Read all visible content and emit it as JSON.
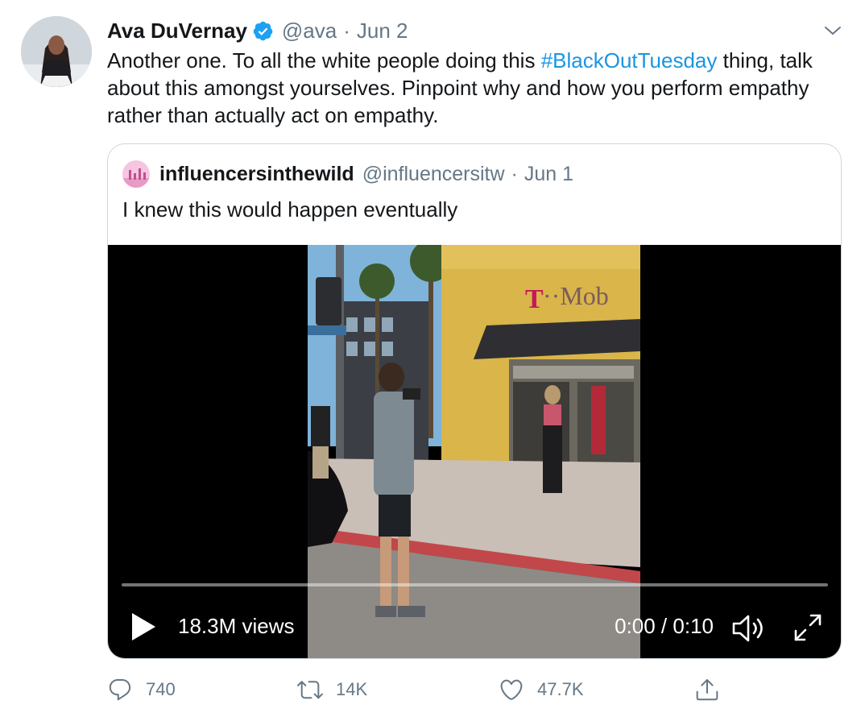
{
  "tweet": {
    "display_name": "Ava DuVernay",
    "handle": "@ava",
    "separator": "·",
    "date": "Jun 2",
    "text_before": "Another one. To all the white people doing this ",
    "hashtag": "#BlackOutTuesday",
    "text_after": " thing, talk about this amongst yourselves. Pinpoint why and how you perform empathy rather than actually act on empathy."
  },
  "quote": {
    "display_name": "influencersinthewild",
    "handle": "@influencersitw",
    "separator": "·",
    "date": "Jun 1",
    "text": "I knew this would happen eventually",
    "video": {
      "views": "18.3M views",
      "time": "0:00 / 0:10",
      "progress": 0
    }
  },
  "actions": {
    "reply_count": "740",
    "retweet_count": "14K",
    "like_count": "47.7K"
  },
  "icons": {
    "verified": "verified-badge-icon",
    "caret": "chevron-down-icon",
    "reply": "reply-icon",
    "retweet": "retweet-icon",
    "like": "heart-icon",
    "share": "share-icon",
    "play": "play-icon",
    "volume": "volume-icon",
    "fullscreen": "fullscreen-icon"
  },
  "colors": {
    "link": "#1b95e0",
    "verified": "#1da1f2",
    "secondary_text": "#657786",
    "border": "#ccd6dd"
  }
}
